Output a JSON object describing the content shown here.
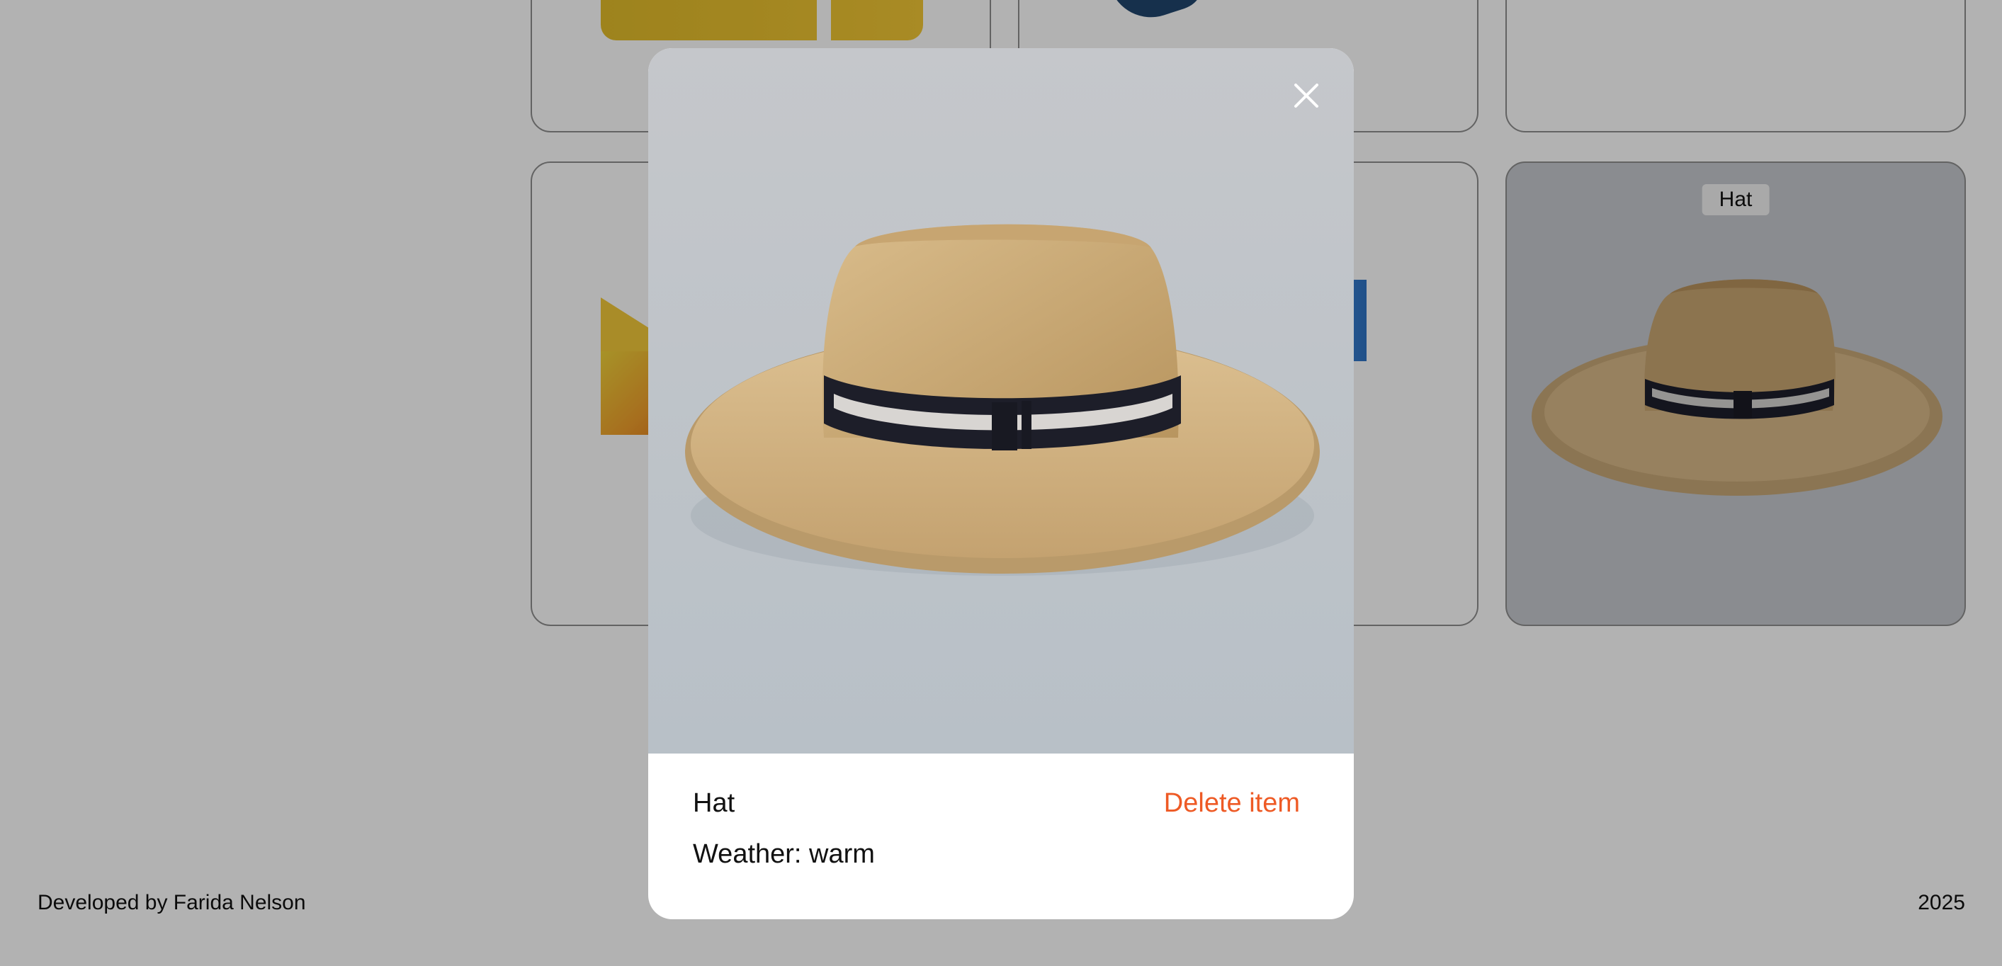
{
  "grid": {
    "cards": [
      {
        "label": ""
      },
      {
        "label": ""
      },
      {
        "label": ""
      },
      {
        "label": ""
      },
      {
        "label": ""
      },
      {
        "label": "Hat"
      }
    ]
  },
  "footer": {
    "credit": "Developed by Farida Nelson",
    "year": "2025"
  },
  "modal": {
    "item_name": "Hat",
    "weather": "Weather: warm",
    "delete_label": "Delete item",
    "close_icon": "close-icon"
  },
  "colors": {
    "accent": "#ee5a25",
    "backdrop": "#b2b2b2",
    "modal_bg": "#ffffff"
  }
}
